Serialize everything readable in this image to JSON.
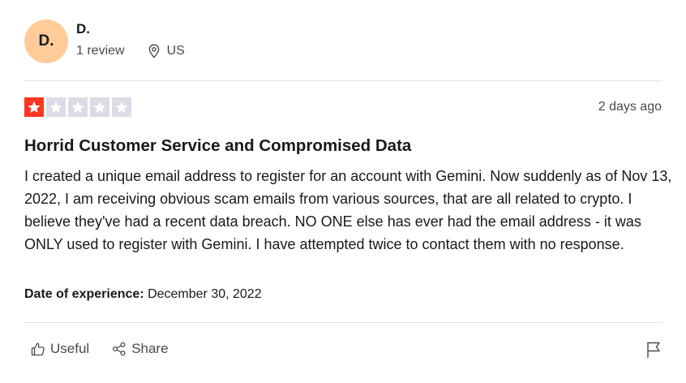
{
  "author": {
    "initials": "D.",
    "name": "D.",
    "review_count": "1 review",
    "country": "US",
    "avatar_color": "#ffcc99"
  },
  "review": {
    "rating": 1,
    "rating_max": 5,
    "star_filled_color": "#ff3722",
    "star_empty_color": "#dcdce6",
    "posted": "2 days ago",
    "title": "Horrid Customer Service and Compromised Data",
    "body": "I created a unique email address to register for an account with Gemini. Now suddenly as of Nov 13, 2022, I am receiving obvious scam emails from various sources, that are all related to crypto. I believe they've had a recent data breach. NO ONE else has ever had the email address - it was ONLY used to register with Gemini. I have attempted twice to contact them with no response.",
    "experience_label": "Date of experience:",
    "experience_date": "December 30, 2022"
  },
  "actions": {
    "useful_label": "Useful",
    "share_label": "Share",
    "useful_icon": "thumbs-up-icon",
    "share_icon": "share-icon",
    "flag_icon": "flag-icon"
  }
}
